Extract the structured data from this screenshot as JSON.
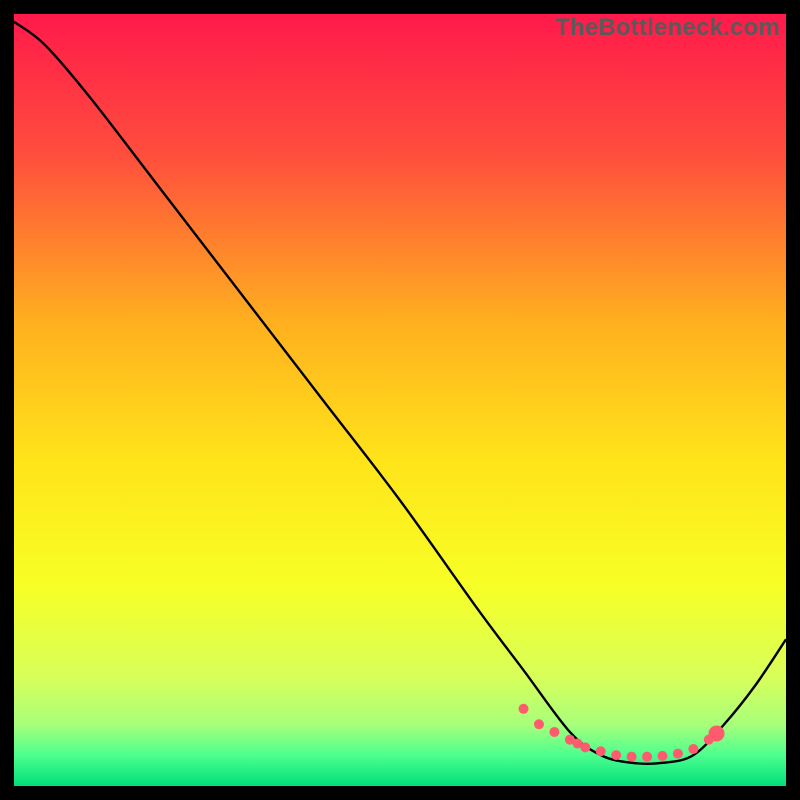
{
  "watermark": "TheBottleneck.com",
  "chart_data": {
    "type": "line",
    "title": "",
    "xlabel": "",
    "ylabel": "",
    "xlim": [
      0,
      100
    ],
    "ylim": [
      0,
      100
    ],
    "grid": false,
    "legend": false,
    "gradient_stops": [
      {
        "offset": 0,
        "color": "#ff1a4b"
      },
      {
        "offset": 18,
        "color": "#ff4d3d"
      },
      {
        "offset": 40,
        "color": "#ffb01f"
      },
      {
        "offset": 58,
        "color": "#ffe41a"
      },
      {
        "offset": 74,
        "color": "#f7ff26"
      },
      {
        "offset": 86,
        "color": "#d7ff5a"
      },
      {
        "offset": 92,
        "color": "#a8ff7a"
      },
      {
        "offset": 96,
        "color": "#4dff8f"
      },
      {
        "offset": 100,
        "color": "#00e07a"
      }
    ],
    "curve_description": "Steep descending line from top-left toward lower-right, flattening into a trough around x≈72–88, then rising again toward the right edge.",
    "x": [
      0,
      4,
      10,
      20,
      30,
      40,
      50,
      60,
      66,
      72,
      76,
      80,
      84,
      88,
      92,
      96,
      100
    ],
    "y": [
      99,
      96,
      89,
      76,
      63,
      50,
      37,
      23,
      15,
      7,
      4,
      3,
      3,
      4,
      8,
      13,
      19
    ],
    "marker_points": {
      "x": [
        66,
        68,
        70,
        72,
        73,
        74,
        76,
        78,
        80,
        82,
        84,
        86,
        88,
        90,
        91
      ],
      "y": [
        10,
        8,
        7,
        6,
        5.5,
        5,
        4.5,
        4,
        3.8,
        3.8,
        3.9,
        4.2,
        4.8,
        6,
        6.8
      ]
    },
    "marker_style": {
      "color": "#ff5a6e",
      "radius_small": 5,
      "radius_large": 8,
      "large_indices": [
        14
      ]
    }
  }
}
